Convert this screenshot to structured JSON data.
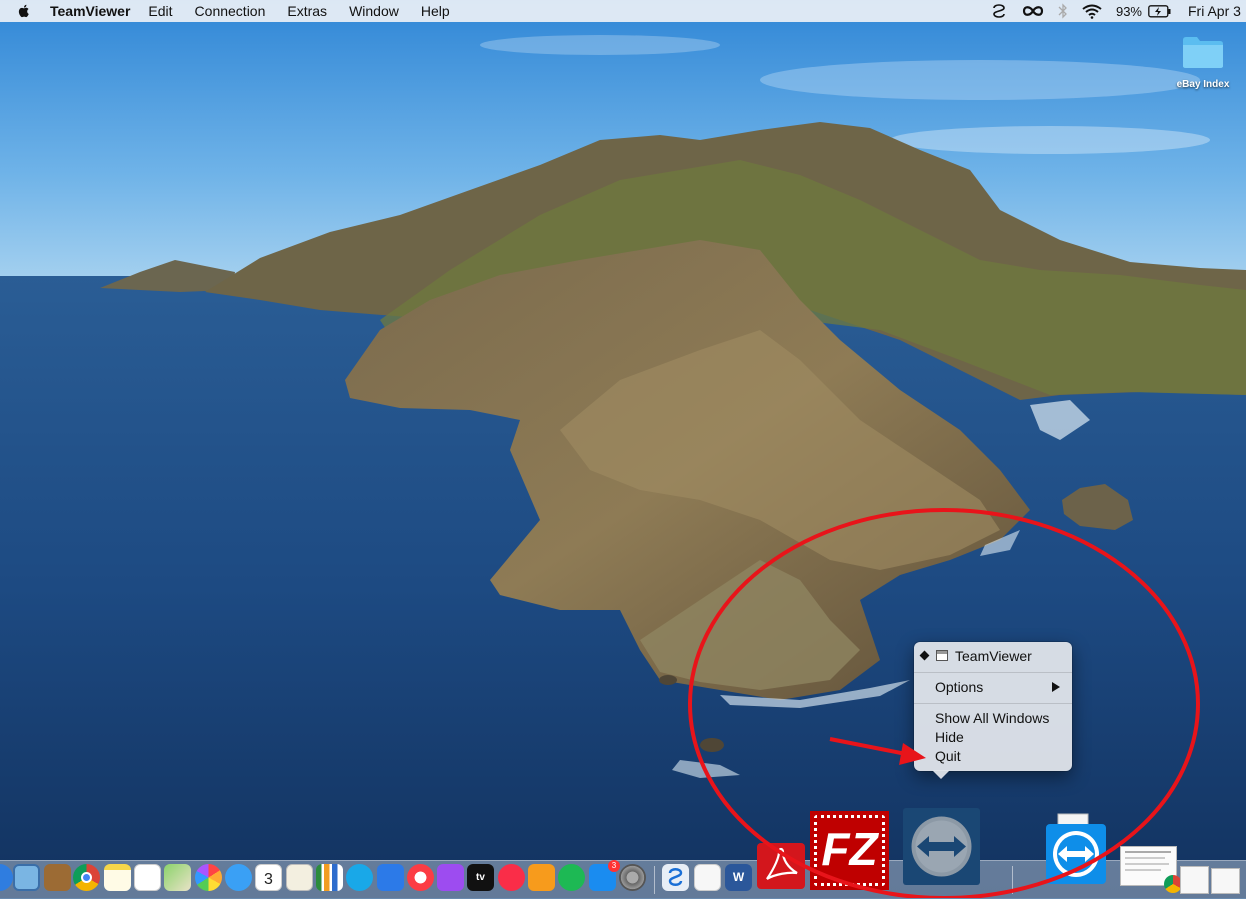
{
  "menubar": {
    "app_name": "TeamViewer",
    "items": [
      "Edit",
      "Connection",
      "Extras",
      "Window",
      "Help"
    ],
    "battery_percent": "93%",
    "clock": "Fri Apr 3"
  },
  "desktop": {
    "folder_label": "eBay Index"
  },
  "context_menu": {
    "title_item": "TeamViewer",
    "options": "Options",
    "show_all_windows": "Show All Windows",
    "hide": "Hide",
    "quit": "Quit"
  },
  "dock": {
    "calendar_day": "3",
    "word_letter": "W",
    "filezilla_text": "FZ",
    "appletv_text": "tv",
    "appstore_badge": "3"
  },
  "colors": {
    "annotation_red": "#e8141a",
    "teamviewer_blue": "#0e8ee9",
    "acrobat_red": "#d3161c",
    "filezilla_red": "#bf0000"
  }
}
